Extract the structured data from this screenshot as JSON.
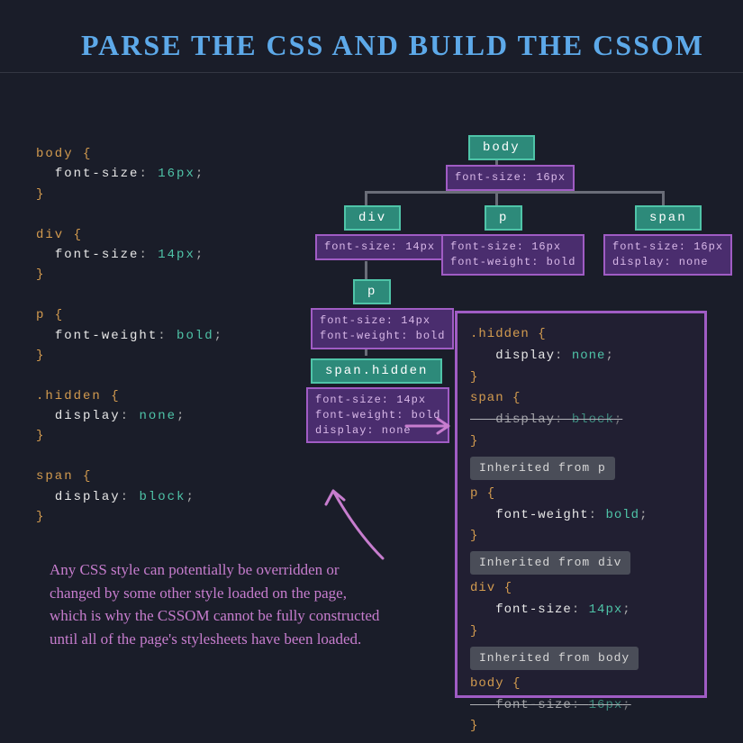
{
  "title": "PARSE THE CSS AND BUILD THE CSSOM",
  "css": {
    "r0_sel": "body",
    "r0_prop": "font-size",
    "r0_val": "16px",
    "r1_sel": "div",
    "r1_prop": "font-size",
    "r1_val": "14px",
    "r2_sel": "p",
    "r2_prop": "font-weight",
    "r2_val": "bold",
    "r3_sel": ".hidden",
    "r3_prop": "display",
    "r3_val": "none",
    "r4_sel": "span",
    "r4_prop": "display",
    "r4_val": "block"
  },
  "tree": {
    "body_tag": "body",
    "body_styles": "font-size: 16px",
    "div_tag": "div",
    "div_styles": "font-size: 14px",
    "p_tag": "p",
    "p_styles": "font-size: 16px\nfont-weight: bold",
    "span_tag": "span",
    "span_styles": "font-size: 16px\ndisplay: none",
    "p2_tag": "p",
    "p2_styles": "font-size: 14px\nfont-weight: bold",
    "sh_tag": "span.hidden",
    "sh_styles": "font-size: 14px\nfont-weight: bold\ndisplay: none"
  },
  "explain": "Any CSS style can potentially be overridden or changed by some other style loaded on the page, which is why the CSSOM cannot be fully constructed until all of the page's stylesheets have been loaded.",
  "inspector": {
    "hidden_sel": ".hidden",
    "hidden_prop": "display",
    "hidden_val": "none",
    "span_sel": "span",
    "span_prop": "display",
    "span_val": "block",
    "inh_p": "Inherited from p",
    "p_sel": "p",
    "p_prop": "font-weight",
    "p_val": "bold",
    "inh_div": "Inherited from div",
    "div_sel": "div",
    "div_prop": "font-size",
    "div_val": "14px",
    "inh_body": "Inherited from body",
    "body_sel": "body",
    "body_prop": "font-size",
    "body_val": "16px"
  },
  "punc": {
    "open": " {",
    "close": "}",
    "colon": ": ",
    "semi": ";"
  }
}
